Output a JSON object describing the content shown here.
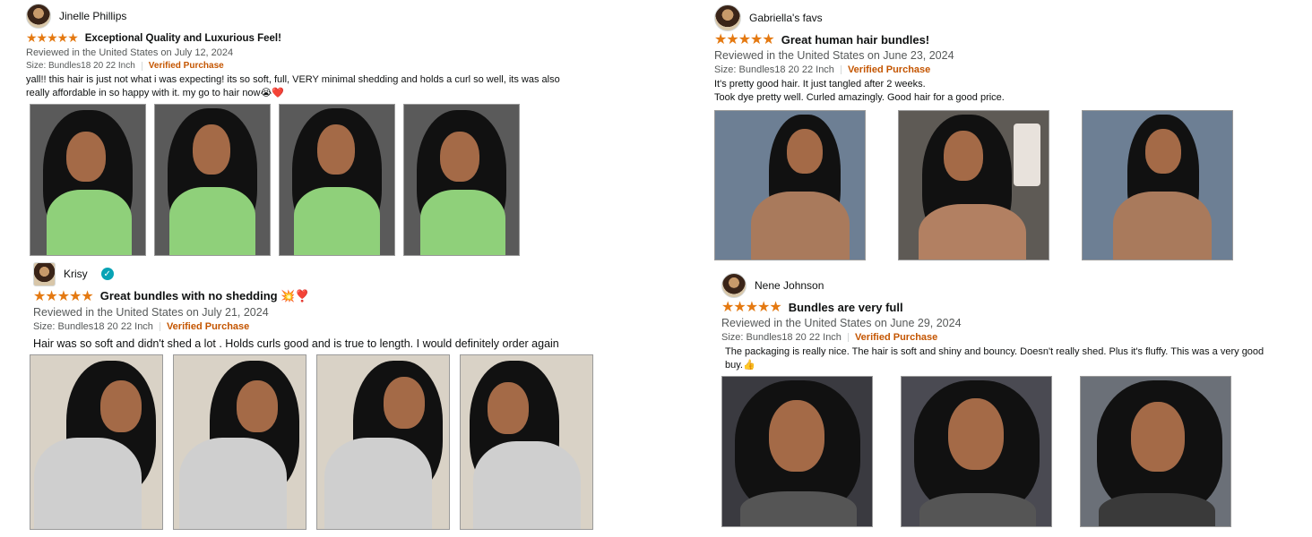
{
  "reviews": [
    {
      "reviewer": "Jinelle Phillips",
      "stars": "★★★★★",
      "title": "Exceptional Quality and Luxurious Feel!",
      "meta": "Reviewed in the United States on July 12, 2024",
      "size": "Size: Bundles18 20 22 Inch",
      "verified": "Verified Purchase",
      "body": "yall!! this hair is just not what i was expecting! its so soft, full, VERY minimal shedding and holds a curl so well, its was also really affordable in so happy with it. my go to hair now😭❤️",
      "image_count": 4
    },
    {
      "reviewer": "Krisy",
      "stars": "★★★★★",
      "title": "Great bundles with no shedding 💥❣️",
      "meta": "Reviewed in the United States on July 21, 2024",
      "size": "Size: Bundles18 20 22 Inch",
      "verified": "Verified Purchase",
      "body": "Hair was so soft and didn't shed a lot . Holds curls good and is true to length. I would definitely order again",
      "verified_badge": "✓",
      "image_count": 4
    },
    {
      "reviewer": "Gabriella's favs",
      "stars": "★★★★★",
      "title": "Great human hair bundles!",
      "meta": "Reviewed in the United States on June 23, 2024",
      "size": "Size: Bundles18 20 22 Inch",
      "verified": "Verified Purchase",
      "body_lines": [
        "It's pretty good hair. It just tangled after 2 weeks.",
        "Took dye pretty well. Curled amazingly. Good hair for a good price."
      ],
      "image_count": 3
    },
    {
      "reviewer": "Nene Johnson",
      "stars": "★★★★★",
      "title": "Bundles are very full",
      "meta": "Reviewed in the United States on June 29, 2024",
      "size": "Size: Bundles18 20 22 Inch",
      "verified": "Verified Purchase",
      "body": "The packaging is really nice. The hair is soft and shiny and bouncy. Doesn't really shed. Plus it's fluffy. This was a very good buy.👍",
      "image_count": 3
    }
  ],
  "colors": {
    "star": "#e47911",
    "verified": "#c45500",
    "meta": "#565959",
    "badge": "#08a3b5"
  }
}
